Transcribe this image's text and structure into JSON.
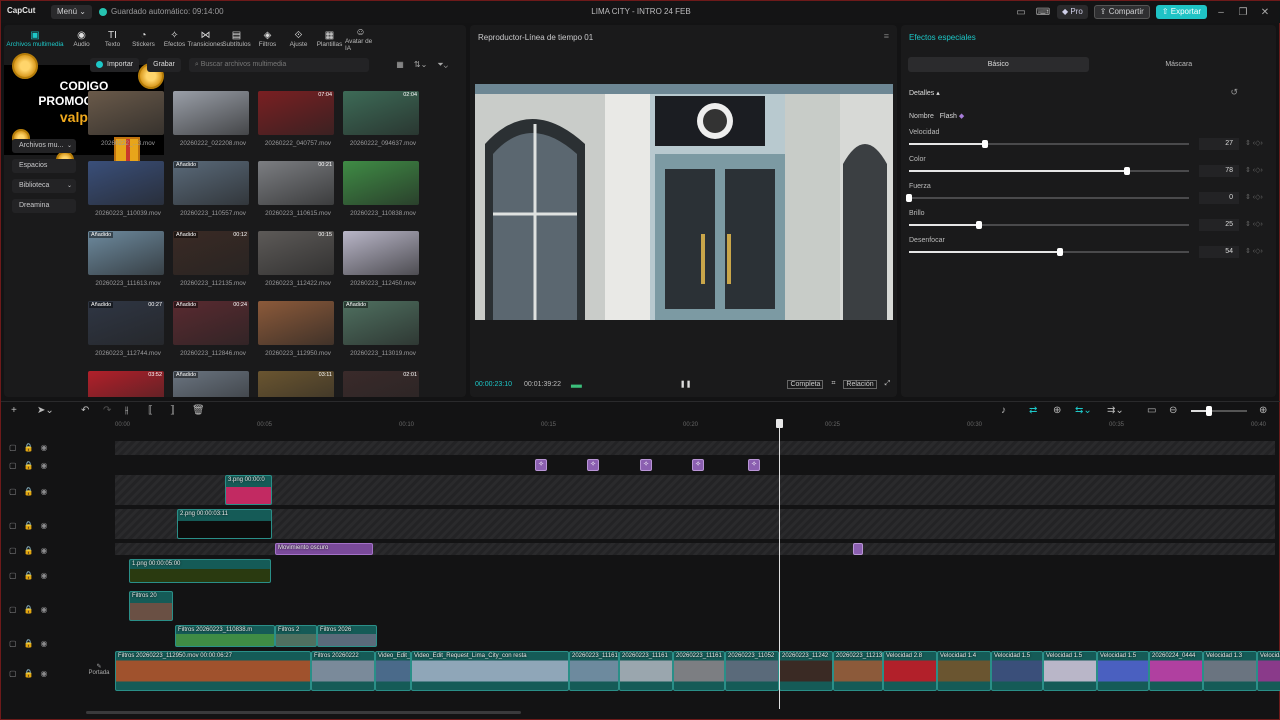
{
  "titlebar": {
    "logo": "CapCut",
    "menu_label": "Menú",
    "autosave": "Guardado automático: 09:14:00",
    "title": "LIMA CITY - INTRO 24 FEB",
    "pro_label": "Pro",
    "share_label": "Compartir",
    "export_label": "Exportar"
  },
  "toolbar": {
    "tools": [
      {
        "label": "Archivos multimedia",
        "icon": "media-icon",
        "glyph": "▣"
      },
      {
        "label": "Audio",
        "icon": "audio-icon",
        "glyph": "◉"
      },
      {
        "label": "Texto",
        "icon": "text-icon",
        "glyph": "TI"
      },
      {
        "label": "Stickers",
        "icon": "sticker-icon",
        "glyph": "◔"
      },
      {
        "label": "Efectos",
        "icon": "effects-icon",
        "glyph": "✧"
      },
      {
        "label": "Transiciones",
        "icon": "transition-icon",
        "glyph": "⋈"
      },
      {
        "label": "Subtítulos",
        "icon": "subtitle-icon",
        "glyph": "▤"
      },
      {
        "label": "Filtros",
        "icon": "filter-icon",
        "glyph": "◈"
      },
      {
        "label": "Ajuste",
        "icon": "adjust-icon",
        "glyph": "⟐"
      },
      {
        "label": "Plantillas",
        "icon": "template-icon",
        "glyph": "▦"
      },
      {
        "label": "Avatar de IA",
        "icon": "avatar-icon",
        "glyph": "☺"
      }
    ]
  },
  "promo": {
    "line1": "CODIGO",
    "line2": "PROMOCIONAL",
    "line3": "valpink"
  },
  "sidebar": {
    "items": [
      {
        "label": "Archivos mu..."
      },
      {
        "label": "Espacios"
      },
      {
        "label": "Biblioteca"
      },
      {
        "label": "Dreamina"
      }
    ]
  },
  "media": {
    "import_label": "Importar",
    "record_label": "Grabar",
    "search_placeholder": "Buscar archivos multimedia",
    "items": [
      {
        "name": "20260222_...3.mov",
        "tag": "",
        "duration": "",
        "color": "#6a5a4a"
      },
      {
        "name": "20260222_022208.mov",
        "tag": "",
        "duration": "",
        "color": "#9a9fa8"
      },
      {
        "name": "20260222_040757.mov",
        "tag": "",
        "duration": "07:04",
        "color": "#7a1f22"
      },
      {
        "name": "20260222_094637.mov",
        "tag": "",
        "duration": "02:04",
        "color": "#3d6b57"
      },
      {
        "name": "20260223_110039.mov",
        "tag": "",
        "duration": "",
        "color": "#3a4f7a"
      },
      {
        "name": "20260223_110557.mov",
        "tag": "Añadido",
        "duration": "",
        "color": "#5a6a7a"
      },
      {
        "name": "20260223_110615.mov",
        "tag": "",
        "duration": "00:21",
        "color": "#7c7e82"
      },
      {
        "name": "20260223_110838.mov",
        "tag": "",
        "duration": "",
        "color": "#3f8c45"
      },
      {
        "name": "20260223_111613.mov",
        "tag": "Añadido",
        "duration": "",
        "color": "#6d8a9e"
      },
      {
        "name": "20260223_112135.mov",
        "tag": "Añadido",
        "duration": "00:12",
        "color": "#3a2a24"
      },
      {
        "name": "20260223_112422.mov",
        "tag": "",
        "duration": "00:15",
        "color": "#5d5a58"
      },
      {
        "name": "20260223_112450.mov",
        "tag": "",
        "duration": "",
        "color": "#b9b6c8"
      },
      {
        "name": "20260223_112744.mov",
        "tag": "Añadido",
        "duration": "00:27",
        "color": "#2f3644"
      },
      {
        "name": "20260223_112846.mov",
        "tag": "Añadido",
        "duration": "00:24",
        "color": "#5a2a30"
      },
      {
        "name": "20260223_112950.mov",
        "tag": "",
        "duration": "",
        "color": "#8c5a3a"
      },
      {
        "name": "20260223_113019.mov",
        "tag": "Añadido",
        "duration": "",
        "color": "#4f7060"
      },
      {
        "name": "",
        "tag": "",
        "duration": "03:52",
        "color": "#b2202a"
      },
      {
        "name": "",
        "tag": "Añadido",
        "duration": "",
        "color": "#6a7480"
      },
      {
        "name": "",
        "tag": "",
        "duration": "03:11",
        "color": "#6a5530"
      },
      {
        "name": "",
        "tag": "",
        "duration": "02:01",
        "color": "#3a2a2a"
      }
    ]
  },
  "player": {
    "title": "Reproductor-Línea de tiempo 01",
    "current_time": "00:00:23:10",
    "total_time": "00:01:39:22",
    "full_label": "Completa",
    "ratio_label": "Relación"
  },
  "effects": {
    "title": "Efectos especiales",
    "tab_basic": "Básico",
    "tab_mask": "Máscara",
    "details_label": "Detalles",
    "name_label": "Nombre",
    "name_value": "Flash",
    "params": [
      {
        "label": "Velocidad",
        "value": "27",
        "level": 0.27
      },
      {
        "label": "Color",
        "value": "78",
        "level": 0.78
      },
      {
        "label": "Fuerza",
        "value": "0",
        "level": 0.0
      },
      {
        "label": "Brillo",
        "value": "25",
        "level": 0.25
      },
      {
        "label": "Desenfocar",
        "value": "54",
        "level": 0.54
      }
    ]
  },
  "timeline": {
    "ruler": [
      "00:00",
      "00:05",
      "00:10",
      "00:15",
      "00:20",
      "00:25",
      "00:30",
      "00:35",
      "00:40"
    ],
    "cover_label": "Portada",
    "clips": {
      "img3": "3.png  00:00:0",
      "img2": "2.png  00:00:03:11",
      "movement": "Movimiento oscuro",
      "img1": "1.png  00:00:05:00",
      "filtros_a": "Filtros  20",
      "filtros_b": "Filtros  20260223_110838.m",
      "filtros_c": "Filtros  2",
      "filtros_d": "Filtros  2026",
      "main": [
        "Filtros  20260223_112950.mov  00:00:06:27",
        "Filtros  20260222",
        "Video_Edit_",
        "Video_Edit_Request_Lima_City_con resta",
        "20260223_11161",
        "20260223_11161",
        "20260223_11161",
        "20260223_11052",
        "20260223_11242",
        "20260223_11213",
        "Velocidad 2.8",
        "Velocidad 1.4",
        "Velocidad 1.5",
        "Velocidad 1.5",
        "Velocidad 1.5",
        "20260224_0444",
        "Velocidad 1.3",
        "Velocidad"
      ]
    }
  }
}
